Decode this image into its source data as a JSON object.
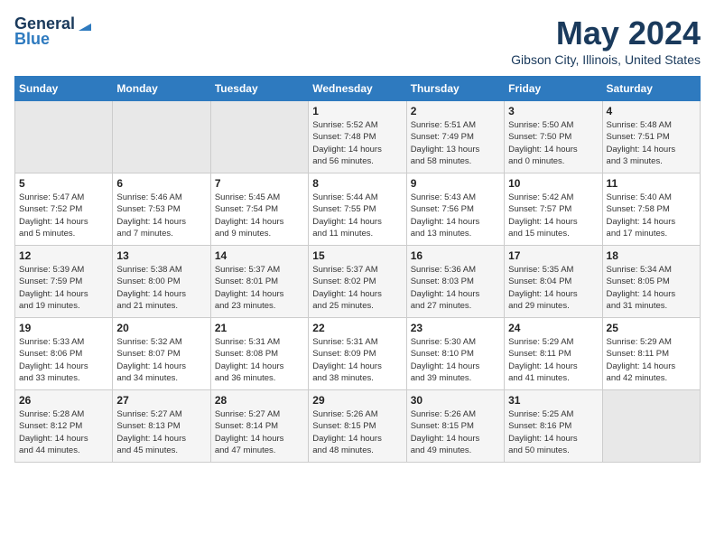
{
  "header": {
    "logo_general": "General",
    "logo_blue": "Blue",
    "month": "May 2024",
    "location": "Gibson City, Illinois, United States"
  },
  "days_of_week": [
    "Sunday",
    "Monday",
    "Tuesday",
    "Wednesday",
    "Thursday",
    "Friday",
    "Saturday"
  ],
  "weeks": [
    [
      {
        "day": "",
        "info": ""
      },
      {
        "day": "",
        "info": ""
      },
      {
        "day": "",
        "info": ""
      },
      {
        "day": "1",
        "info": "Sunrise: 5:52 AM\nSunset: 7:48 PM\nDaylight: 14 hours\nand 56 minutes."
      },
      {
        "day": "2",
        "info": "Sunrise: 5:51 AM\nSunset: 7:49 PM\nDaylight: 13 hours\nand 58 minutes."
      },
      {
        "day": "3",
        "info": "Sunrise: 5:50 AM\nSunset: 7:50 PM\nDaylight: 14 hours\nand 0 minutes."
      },
      {
        "day": "4",
        "info": "Sunrise: 5:48 AM\nSunset: 7:51 PM\nDaylight: 14 hours\nand 3 minutes."
      }
    ],
    [
      {
        "day": "5",
        "info": "Sunrise: 5:47 AM\nSunset: 7:52 PM\nDaylight: 14 hours\nand 5 minutes."
      },
      {
        "day": "6",
        "info": "Sunrise: 5:46 AM\nSunset: 7:53 PM\nDaylight: 14 hours\nand 7 minutes."
      },
      {
        "day": "7",
        "info": "Sunrise: 5:45 AM\nSunset: 7:54 PM\nDaylight: 14 hours\nand 9 minutes."
      },
      {
        "day": "8",
        "info": "Sunrise: 5:44 AM\nSunset: 7:55 PM\nDaylight: 14 hours\nand 11 minutes."
      },
      {
        "day": "9",
        "info": "Sunrise: 5:43 AM\nSunset: 7:56 PM\nDaylight: 14 hours\nand 13 minutes."
      },
      {
        "day": "10",
        "info": "Sunrise: 5:42 AM\nSunset: 7:57 PM\nDaylight: 14 hours\nand 15 minutes."
      },
      {
        "day": "11",
        "info": "Sunrise: 5:40 AM\nSunset: 7:58 PM\nDaylight: 14 hours\nand 17 minutes."
      }
    ],
    [
      {
        "day": "12",
        "info": "Sunrise: 5:39 AM\nSunset: 7:59 PM\nDaylight: 14 hours\nand 19 minutes."
      },
      {
        "day": "13",
        "info": "Sunrise: 5:38 AM\nSunset: 8:00 PM\nDaylight: 14 hours\nand 21 minutes."
      },
      {
        "day": "14",
        "info": "Sunrise: 5:37 AM\nSunset: 8:01 PM\nDaylight: 14 hours\nand 23 minutes."
      },
      {
        "day": "15",
        "info": "Sunrise: 5:37 AM\nSunset: 8:02 PM\nDaylight: 14 hours\nand 25 minutes."
      },
      {
        "day": "16",
        "info": "Sunrise: 5:36 AM\nSunset: 8:03 PM\nDaylight: 14 hours\nand 27 minutes."
      },
      {
        "day": "17",
        "info": "Sunrise: 5:35 AM\nSunset: 8:04 PM\nDaylight: 14 hours\nand 29 minutes."
      },
      {
        "day": "18",
        "info": "Sunrise: 5:34 AM\nSunset: 8:05 PM\nDaylight: 14 hours\nand 31 minutes."
      }
    ],
    [
      {
        "day": "19",
        "info": "Sunrise: 5:33 AM\nSunset: 8:06 PM\nDaylight: 14 hours\nand 33 minutes."
      },
      {
        "day": "20",
        "info": "Sunrise: 5:32 AM\nSunset: 8:07 PM\nDaylight: 14 hours\nand 34 minutes."
      },
      {
        "day": "21",
        "info": "Sunrise: 5:31 AM\nSunset: 8:08 PM\nDaylight: 14 hours\nand 36 minutes."
      },
      {
        "day": "22",
        "info": "Sunrise: 5:31 AM\nSunset: 8:09 PM\nDaylight: 14 hours\nand 38 minutes."
      },
      {
        "day": "23",
        "info": "Sunrise: 5:30 AM\nSunset: 8:10 PM\nDaylight: 14 hours\nand 39 minutes."
      },
      {
        "day": "24",
        "info": "Sunrise: 5:29 AM\nSunset: 8:11 PM\nDaylight: 14 hours\nand 41 minutes."
      },
      {
        "day": "25",
        "info": "Sunrise: 5:29 AM\nSunset: 8:11 PM\nDaylight: 14 hours\nand 42 minutes."
      }
    ],
    [
      {
        "day": "26",
        "info": "Sunrise: 5:28 AM\nSunset: 8:12 PM\nDaylight: 14 hours\nand 44 minutes."
      },
      {
        "day": "27",
        "info": "Sunrise: 5:27 AM\nSunset: 8:13 PM\nDaylight: 14 hours\nand 45 minutes."
      },
      {
        "day": "28",
        "info": "Sunrise: 5:27 AM\nSunset: 8:14 PM\nDaylight: 14 hours\nand 47 minutes."
      },
      {
        "day": "29",
        "info": "Sunrise: 5:26 AM\nSunset: 8:15 PM\nDaylight: 14 hours\nand 48 minutes."
      },
      {
        "day": "30",
        "info": "Sunrise: 5:26 AM\nSunset: 8:15 PM\nDaylight: 14 hours\nand 49 minutes."
      },
      {
        "day": "31",
        "info": "Sunrise: 5:25 AM\nSunset: 8:16 PM\nDaylight: 14 hours\nand 50 minutes."
      },
      {
        "day": "",
        "info": ""
      }
    ]
  ]
}
